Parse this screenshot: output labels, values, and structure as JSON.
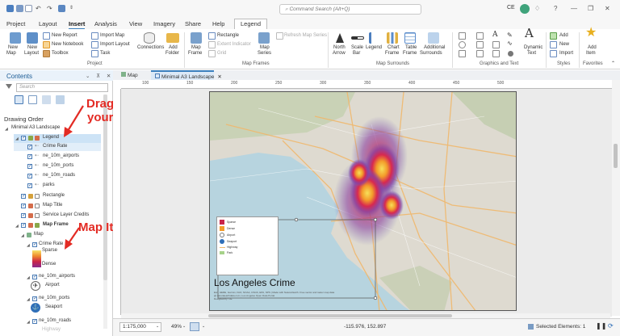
{
  "title_bar": {
    "search_placeholder": "Command Search (Alt+Q)",
    "user_initials": "CE",
    "right_icons": [
      "bell-icon",
      "question-icon",
      "minimize-icon",
      "restore-icon",
      "close-icon"
    ]
  },
  "menu": {
    "items": [
      "Project",
      "Layout",
      "Insert",
      "Analysis",
      "View",
      "Imagery",
      "Share",
      "Help",
      "Legend"
    ],
    "active": "Insert"
  },
  "ribbon": {
    "project": {
      "new_map": "New",
      "new_map_sub": "Map",
      "new_layout": "New",
      "new_layout_sub": "Layout",
      "new_report": "New Report",
      "new_notebook": "New Notebook",
      "toolbox": "Toolbox",
      "import_map": "Import Map",
      "import_layout": "Import Layout",
      "task": "Task",
      "connections": "Connections",
      "add_folder": "Add",
      "add_folder_sub": "Folder",
      "group_label": "Project"
    },
    "map_frames": {
      "map_frame": "Map",
      "map_frame_sub": "Frame",
      "rectangle": "Rectangle",
      "extent_indicator": "Extent Indicator",
      "grid": "Grid",
      "map_series": "Map",
      "map_series_sub": "Series",
      "refresh_map_series": "Refresh Map Series",
      "group_label": "Map Frames"
    },
    "map_surrounds": {
      "north_arrow": "North",
      "north_arrow_sub": "Arrow",
      "scale_bar": "Scale",
      "scale_bar_sub": "Bar",
      "legend": "Legend",
      "chart_frame": "Chart",
      "chart_frame_sub": "Frame",
      "table_frame": "Table",
      "table_frame_sub": "Frame",
      "additional": "Additional",
      "additional_sub": "Surrounds",
      "group_label": "Map Surrounds"
    },
    "graphics": {
      "dynamic_text": "Dynamic",
      "dynamic_text_sub": "Text",
      "group_label": "Graphics and Text"
    },
    "styles": {
      "add": "Add",
      "new": "New",
      "import": "Import",
      "group_label": "Styles"
    },
    "favorites": {
      "add_item": "Add",
      "add_item_sub": "Item",
      "group_label": "Favorites"
    }
  },
  "contents": {
    "title": "Contents",
    "search_placeholder": "Search",
    "drawing_order": "Drawing Order",
    "tree": [
      {
        "label": "Minimal A3 Landscape",
        "level": 0
      },
      {
        "label": "Legend",
        "level": 1
      },
      {
        "label": "Crime Rate",
        "level": 2
      },
      {
        "label": "ne_10m_airports",
        "level": 2
      },
      {
        "label": "ne_10m_ports",
        "level": 2
      },
      {
        "label": "ne_10m_roads",
        "level": 2
      },
      {
        "label": "parks",
        "level": 2
      },
      {
        "label": "Rectangle",
        "level": 1
      },
      {
        "label": "Map Title",
        "level": 1
      },
      {
        "label": "Service Layer Credits",
        "level": 1
      },
      {
        "label": "Map Frame",
        "level": 1
      },
      {
        "label": "Map",
        "level": 2
      },
      {
        "label": "Crime Rate",
        "level": 3
      },
      {
        "label": "Sparse",
        "level": 4
      },
      {
        "label": "Dense",
        "level": 4
      },
      {
        "label": "ne_10m_airports",
        "level": 3
      },
      {
        "label": "Airport",
        "level": 4
      },
      {
        "label": "ne_10m_ports",
        "level": 3
      },
      {
        "label": "Seaport",
        "level": 4
      },
      {
        "label": "ne_10m_roads",
        "level": 3
      },
      {
        "label": "Highway",
        "level": 4
      }
    ]
  },
  "annotations": {
    "top_line1": "Drag and Drop into",
    "top_line2": "your legend group",
    "bottom": "Map Items",
    "color": "#e32b24"
  },
  "view": {
    "tabs": [
      "Map",
      "Minimal A3 Landscape"
    ],
    "active_tab": "Minimal A3 Landscape",
    "ruler_labels": [
      "100",
      "150",
      "200",
      "250",
      "300",
      "350",
      "400",
      "450",
      "500"
    ],
    "map_title": "Los Angeles Crime",
    "legend_items": [
      "Sparse",
      "Dense",
      "Airport",
      "Seaport",
      "Highway",
      "Park"
    ],
    "credits": [
      "Esri, HERE, Garmin, FAO, NOAA, USGS, EPA, NPS | Made with Natural Earth. Free vector and raster map data",
      "@ naturalearthdata.com | Los Angeles Open Data Portal",
      "Designed by: CE"
    ]
  },
  "status_bar": {
    "scale": "1:175,000",
    "zoom": "49%",
    "coordinates": "-115.976, 152.897",
    "selected": "Selected Elements: 1"
  }
}
